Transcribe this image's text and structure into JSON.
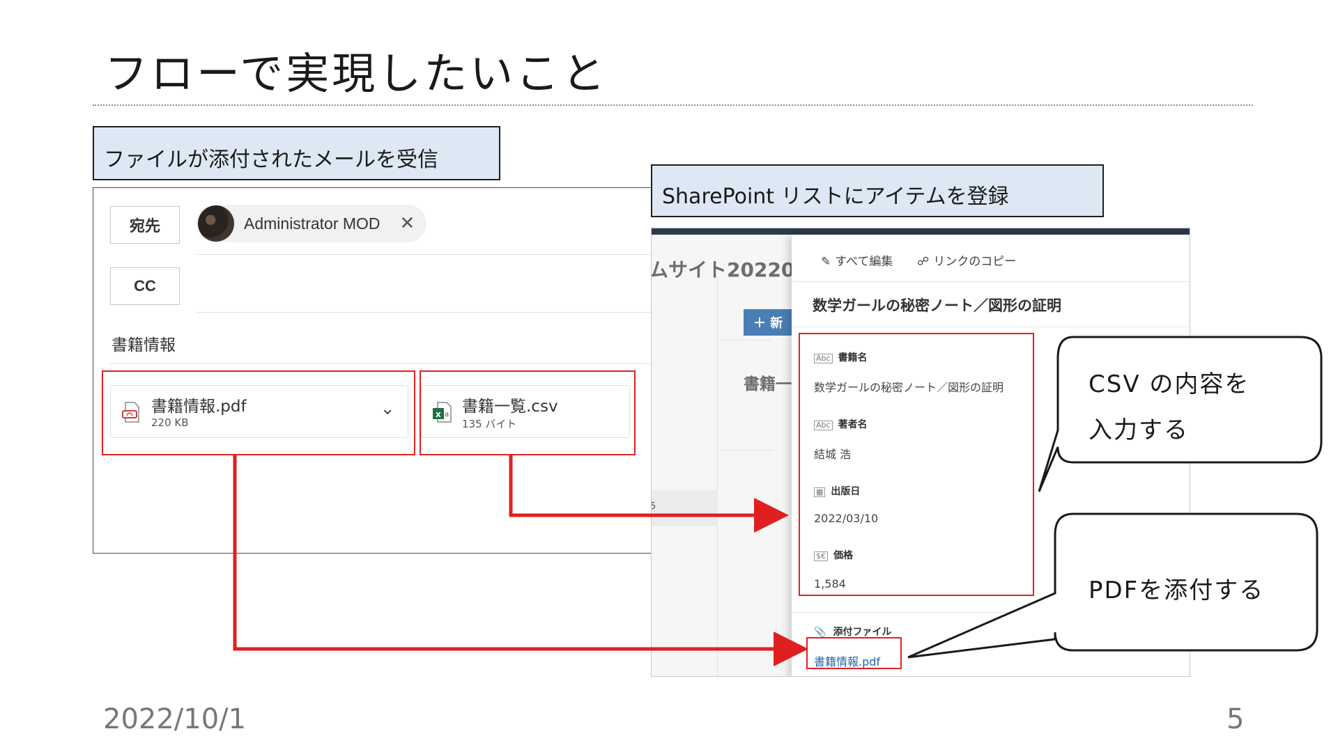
{
  "slide": {
    "title": "フローで実現したいこと",
    "date": "2022/10/1",
    "page_number": "5"
  },
  "labels": {
    "mail": "ファイルが添付されたメールを受信",
    "sharepoint": "SharePoint リストにアイテムを登録"
  },
  "mail": {
    "to_label": "宛先",
    "cc_label": "CC",
    "recipient_name": "Administrator MOD",
    "recipient_remove_glyph": "✕",
    "subject": "書籍情報",
    "attachments": [
      {
        "name": "書籍情報.pdf",
        "size": "220 KB",
        "icon": "pdf-file-icon"
      },
      {
        "name": "書籍一覧.csv",
        "size": "135 バイト",
        "icon": "excel-csv-icon"
      }
    ]
  },
  "sharepoint": {
    "background_title": "ムサイト20220",
    "background_new_button": "＋ 新",
    "background_list_title": "書籍一",
    "background_row_number": "5",
    "commands": {
      "edit_all": "すべて編集",
      "copy_link": "リンクのコピー"
    },
    "item_title": "数学ガールの秘密ノート／図形の証明",
    "fields": [
      {
        "label": "書籍名",
        "value": "数学ガールの秘密ノート／図形の証明",
        "icon": "text-field-icon"
      },
      {
        "label": "著者名",
        "value": "結城 浩",
        "icon": "text-field-icon"
      },
      {
        "label": "出版日",
        "value": "2022/03/10",
        "icon": "calendar-icon"
      },
      {
        "label": "価格",
        "value": "1,584",
        "icon": "currency-icon"
      }
    ],
    "attachments_label": "添付ファイル",
    "attachment_link": "書籍情報.pdf"
  },
  "callouts": {
    "csv_line1": "CSV の内容を",
    "csv_line2": "入力する",
    "pdf": "PDFを添付する"
  },
  "colors": {
    "label_box_bg": "#dde8f4",
    "highlight_red": "#e02020",
    "link_blue": "#2266aa",
    "sp_topbar": "#2d3a4b"
  }
}
